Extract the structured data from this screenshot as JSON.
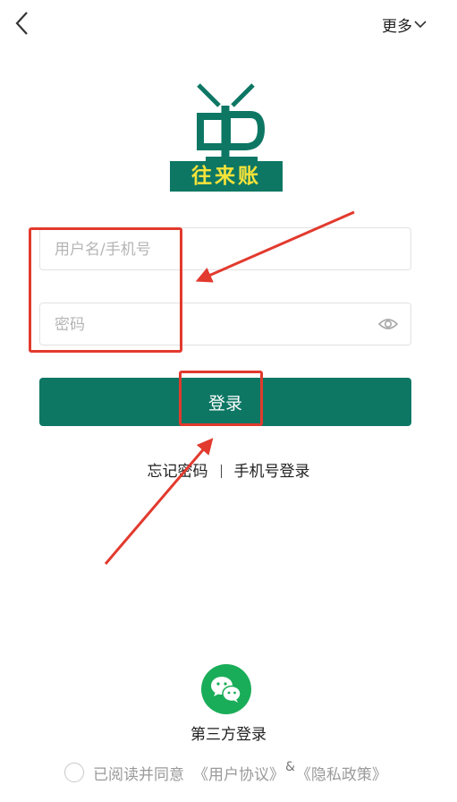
{
  "header": {
    "back_icon": "chevron-left-icon",
    "more_label": "更多",
    "more_icon": "chevron-down-icon"
  },
  "logo": {
    "text": "往来账",
    "colors": {
      "green": "#0d7764",
      "text_bg": "#0d7764",
      "text": "#f5e33a"
    }
  },
  "form": {
    "username_placeholder": "用户名/手机号",
    "username_value": "",
    "password_placeholder": "密码",
    "password_value": "",
    "password_toggle_icon": "eye-icon",
    "login_label": "登录"
  },
  "links": {
    "forgot_password": "忘记密码",
    "phone_login": "手机号登录"
  },
  "third_party": {
    "icon": "wechat-icon",
    "label": "第三方登录"
  },
  "agreement": {
    "checked": false,
    "prefix": "已阅读并同意",
    "user_agreement": "《用户协议》",
    "amp": "&",
    "privacy_policy": "《隐私政策》"
  },
  "colors": {
    "primary": "#0d7764",
    "wechat": "#1aad59",
    "annotation": "#e23a2e",
    "placeholder": "#b5b5b5"
  }
}
